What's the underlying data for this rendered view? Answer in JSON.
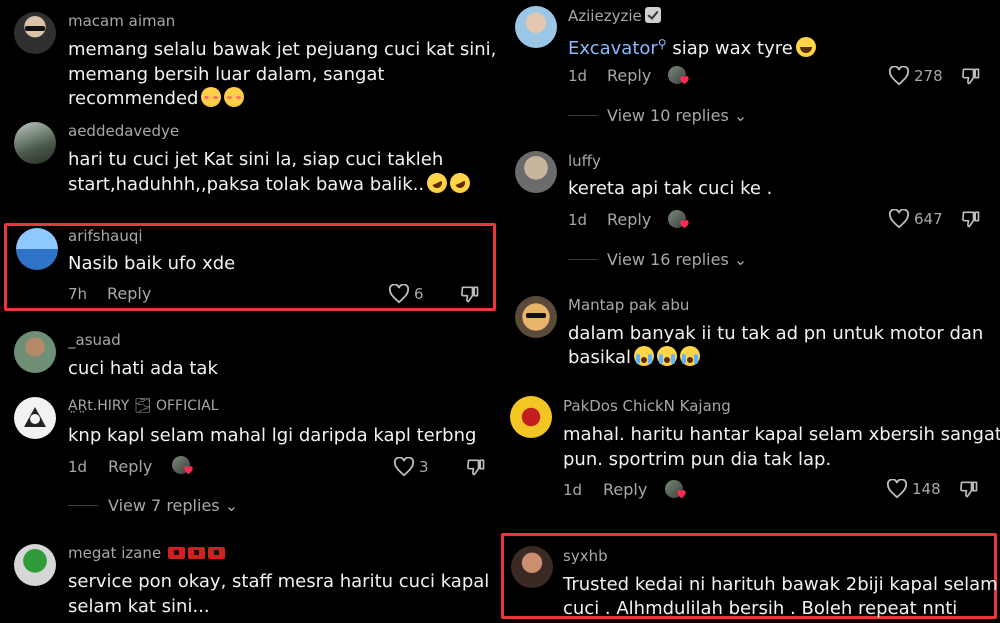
{
  "left_column": {
    "comments": [
      {
        "username": "macam aiman",
        "text_lines": [
          "memang selalu bawak jet pejuang cuci kat sini,",
          "memang bersih luar dalam, sangat",
          "recommended"
        ],
        "emoji": [
          "smiling-face-with-hearts",
          "smiling-face-with-hearts"
        ]
      },
      {
        "username": "aeddedavedye",
        "text_lines": [
          "hari tu cuci jet Kat sini la, siap cuci takleh",
          "start,haduhhh,,paksa tolak bawa balik.."
        ],
        "emoji": [
          "rolling-on-floor-laughing",
          "rolling-on-floor-laughing"
        ]
      },
      {
        "username": "arifshauqi",
        "text_lines": [
          "Nasib baik ufo xde"
        ],
        "time": "7h",
        "reply_label": "Reply",
        "likes": "6",
        "highlighted": true
      },
      {
        "username": "_asuad",
        "text_lines": [
          "cuci hati ada tak"
        ]
      },
      {
        "username": "A̤R̤t.HIRY 🌫 OFFICIAL",
        "text_lines": [
          "knp kapl selam mahal lgi daripda kapl terbng"
        ],
        "time": "1d",
        "reply_label": "Reply",
        "likes": "3",
        "view_replies": "View 7 replies"
      },
      {
        "username": "megat izane",
        "text_lines": [
          "service pon okay, staff mesra haritu cuci kapal",
          "selam kat sini..."
        ],
        "flags": 3
      }
    ]
  },
  "right_column": {
    "comments": [
      {
        "username": "Aziiezyzie",
        "mention": "Excavator",
        "text_lines": [
          "siap wax tyre"
        ],
        "time": "1d",
        "reply_label": "Reply",
        "likes": "278",
        "view_replies": "View 10 replies",
        "emoji": [
          "grinning-squinting-face"
        ]
      },
      {
        "username": "luffy",
        "text_lines": [
          "kereta api tak cuci ke ."
        ],
        "time": "1d",
        "reply_label": "Reply",
        "likes": "647",
        "view_replies": "View 16 replies"
      },
      {
        "username": "Mantap pak abu",
        "text_lines": [
          "dalam banyak ii tu tak ad pn untuk motor dan",
          "basikal"
        ],
        "emoji": [
          "loudly-crying-face",
          "loudly-crying-face",
          "loudly-crying-face"
        ]
      },
      {
        "username": "PakDos ChickN Kajang",
        "text_lines": [
          "mahal. haritu hantar kapal selam xbersih sangat",
          "pun. sportrim pun dia tak lap."
        ],
        "time": "1d",
        "reply_label": "Reply",
        "likes": "148"
      },
      {
        "username": "syxhb",
        "text_lines": [
          "Trusted kedai ni harituh bawak 2biji kapal selam",
          "cuci . Alhmdulilah bersih . Boleh repeat nnti"
        ],
        "highlighted": true
      }
    ]
  },
  "colors": {
    "background": "#000000",
    "text": "#f2f2f2",
    "muted": "#a8a8a8",
    "highlight_border": "#e8383b",
    "mention": "#8bb8ff"
  }
}
